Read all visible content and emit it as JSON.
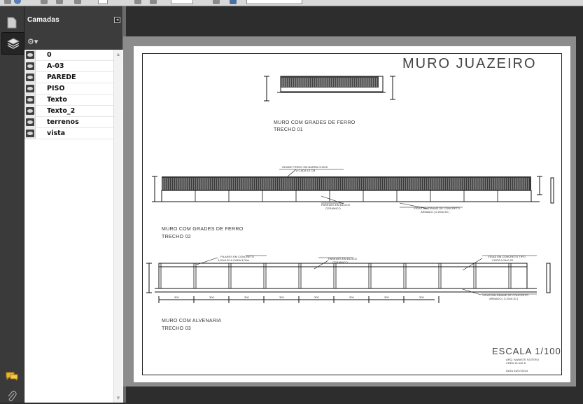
{
  "panel": {
    "title": "Camadas",
    "close_icon": "◂",
    "options_icon": "⚙▾"
  },
  "layers": [
    {
      "name": "0"
    },
    {
      "name": "A-03"
    },
    {
      "name": "PAREDE"
    },
    {
      "name": "PISO"
    },
    {
      "name": "Texto"
    },
    {
      "name": "Texto_2"
    },
    {
      "name": "terrenos"
    },
    {
      "name": "vista"
    }
  ],
  "drawing": {
    "title": "MURO JUAZEIRO",
    "section1": {
      "line1": "MURO COM GRADES DE FERRO",
      "line2": "TRECHO 01"
    },
    "section2": {
      "line1": "MURO COM GRADES DE FERRO",
      "line2": "TRECHO 02"
    },
    "section3": {
      "line1": "MURO COM ALVENARIA",
      "line2": "TRECHO 03"
    },
    "note_grade": "GRADE FERRO EM BARRA CHATA",
    "note_grade2": "A CADA 15 CM",
    "note_pareds": "PAREDES EM BLOCO",
    "note_pareds2": "CERAMICO",
    "note_vigas": "VIGAS BALDRAME DE CONCRETO",
    "note_vigas2": "ARMADO ( 0,20x0,30 )",
    "note_pilares": "PILARES EM CONCRETO",
    "note_pilares2": "0,20x0,20   A CADA 3,00m",
    "note_paredes3": "PAREDES EM BLOCO",
    "note_paredes3b": "CERAMICO",
    "note_vigastipo": "VIGAS EM CONCRETO TIPO",
    "note_vigastipo2": "CINTA 0,15x0,20",
    "note_vigas3": "VIGAS BALDRAME DE CONCRETO",
    "note_vigas3b": "ARMADO ( 0,20x0,30 )",
    "dim_300": "300",
    "scale": "ESCALA 1/100",
    "author1": "ARQ. IVANISTE SOTERO",
    "author2": "CREA 15.442-D",
    "date": "DATA 04/07/2013"
  }
}
